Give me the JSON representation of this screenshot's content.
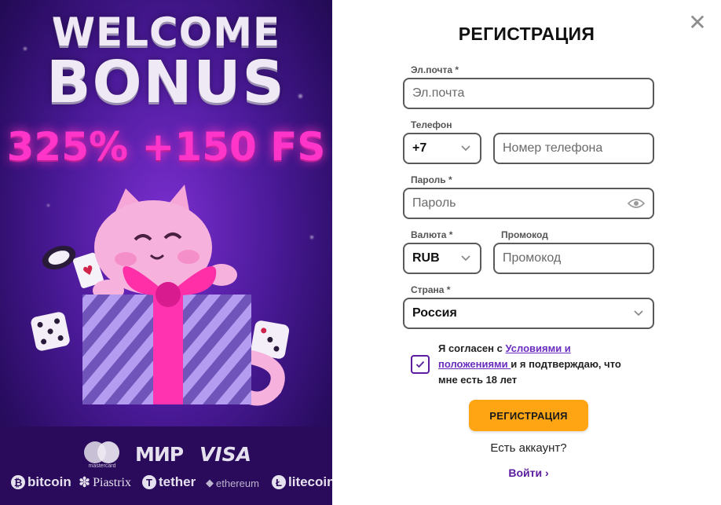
{
  "promo": {
    "title_line1": "WELCOME",
    "title_line2": "BONUS",
    "bonus": "325% +150 FS",
    "payments_row1": {
      "mastercard": "mastercard",
      "mir": "МИР",
      "visa": "VISA"
    },
    "payments_row2": {
      "bitcoin": "bitcoin",
      "piastrix": "Piastrix",
      "tether": "tether",
      "ethereum": "ethereum",
      "litecoin": "litecoin"
    }
  },
  "form": {
    "title": "РЕГИСТРАЦИЯ",
    "close_icon": "close-icon",
    "email": {
      "label": "Эл.почта *",
      "placeholder": "Эл.почта",
      "value": ""
    },
    "phone": {
      "label": "Телефон",
      "code": "+7",
      "placeholder": "Номер телефона",
      "value": ""
    },
    "password": {
      "label": "Пароль *",
      "placeholder": "Пароль",
      "value": "",
      "icon": "eye-icon"
    },
    "currency": {
      "label": "Валюта *",
      "value": "RUB"
    },
    "promo": {
      "label": "Промокод",
      "placeholder": "Промокод",
      "value": ""
    },
    "country": {
      "label": "Страна *",
      "value": "Россия"
    },
    "agree": {
      "checked": true,
      "prefix": "Я согласен с ",
      "link": "Условиями и положениями ",
      "suffix": "и я подтверждаю, что мне есть 18 лет"
    },
    "submit_label": "РЕГИСТРАЦИЯ",
    "have_account": "Есть аккаунт?",
    "login_label": "Войти"
  },
  "colors": {
    "accent_orange": "#ffa514",
    "accent_purple": "#5b1b9e",
    "promo_pink": "#ff34c8",
    "promo_bg": "#4b1a99"
  }
}
